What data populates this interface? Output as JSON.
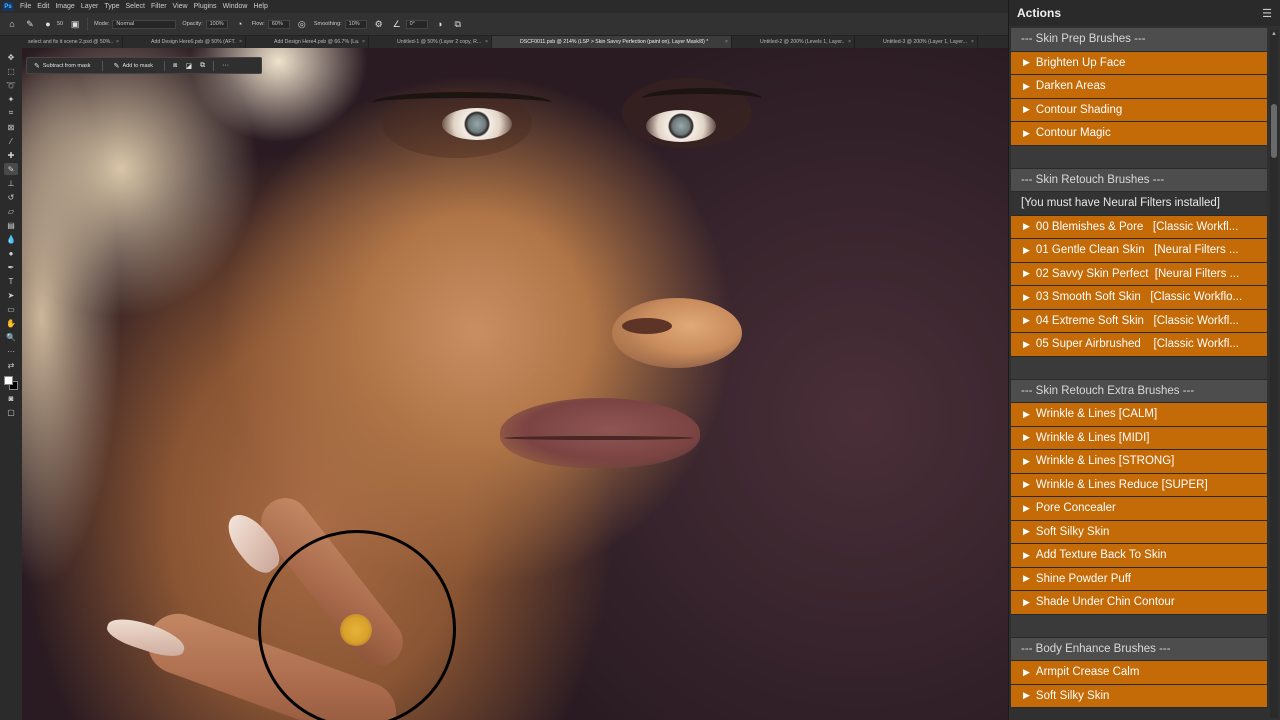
{
  "menu": [
    "File",
    "Edit",
    "Image",
    "Layer",
    "Type",
    "Select",
    "Filter",
    "View",
    "Plugins",
    "Window",
    "Help"
  ],
  "options": {
    "brush_size": "50",
    "mode_label": "Mode:",
    "mode_value": "Normal",
    "opacity_label": "Opacity:",
    "opacity_value": "100%",
    "flow_label": "Flow:",
    "flow_value": "60%",
    "smoothing_label": "Smoothing:",
    "smoothing_value": "10%",
    "angle_value": "0°"
  },
  "tabs": [
    {
      "label": "select and fix it scene 2.psd @ 50%...",
      "active": false
    },
    {
      "label": "Add Design Here6.psb @ 50% (AFT...",
      "active": false
    },
    {
      "label": "Add Design Here4.psb @ 66.7% (La...",
      "active": false
    },
    {
      "label": "Untitled-1 @ 50% (Layer 2 copy, R...",
      "active": false
    },
    {
      "label": "DSCF0011.psb @ 214% (LSP > Skin Savvy Perfection (paint on), Layer Mask/8) *",
      "active": true
    },
    {
      "label": "Untitled-2 @ 200% (Levels 1, Layer...",
      "active": false
    },
    {
      "label": "Untitled-3 @ 200% (Layer 1, Layer...",
      "active": false
    }
  ],
  "mask_tools": {
    "subtract_label": "Subtract from mask",
    "add_label": "Add to mask",
    "more_label": "···"
  },
  "panel": {
    "title": "Actions",
    "rows": [
      {
        "type": "header",
        "label": "--- Skin Prep Brushes ---"
      },
      {
        "type": "action",
        "label": "Brighten Up Face"
      },
      {
        "type": "action",
        "label": "Darken Areas"
      },
      {
        "type": "action",
        "label": "Contour Shading"
      },
      {
        "type": "action",
        "label": "Contour Magic"
      },
      {
        "type": "spacer",
        "label": ""
      },
      {
        "type": "header",
        "label": "--- Skin Retouch Brushes ---"
      },
      {
        "type": "note",
        "label": "[You must have Neural Filters installed]"
      },
      {
        "type": "action",
        "label": "00 Blemishes & Pore   [Classic Workfl..."
      },
      {
        "type": "action",
        "label": "01 Gentle Clean Skin   [Neural Filters ..."
      },
      {
        "type": "action",
        "label": "02 Savvy Skin Perfect  [Neural Filters ..."
      },
      {
        "type": "action",
        "label": "03 Smooth Soft Skin   [Classic Workflo..."
      },
      {
        "type": "action",
        "label": "04 Extreme Soft Skin   [Classic Workfl..."
      },
      {
        "type": "action",
        "label": "05 Super Airbrushed    [Classic Workfl..."
      },
      {
        "type": "spacer",
        "label": ""
      },
      {
        "type": "header",
        "label": "--- Skin Retouch Extra Brushes ---"
      },
      {
        "type": "action",
        "label": "Wrinkle & Lines [CALM]"
      },
      {
        "type": "action",
        "label": "Wrinkle & Lines [MIDI]"
      },
      {
        "type": "action",
        "label": "Wrinkle & Lines [STRONG]"
      },
      {
        "type": "action",
        "label": "Wrinkle & Lines Reduce [SUPER]"
      },
      {
        "type": "action",
        "label": "Pore Concealer"
      },
      {
        "type": "action",
        "label": "Soft Silky Skin"
      },
      {
        "type": "action",
        "label": "Add Texture Back To Skin"
      },
      {
        "type": "action",
        "label": "Shine Powder Puff"
      },
      {
        "type": "action",
        "label": "Shade Under Chin Contour"
      },
      {
        "type": "spacer",
        "label": ""
      },
      {
        "type": "header",
        "label": "--- Body Enhance Brushes ---"
      },
      {
        "type": "action",
        "label": "Armpit Crease Calm"
      },
      {
        "type": "action",
        "label": "Soft Silky Skin"
      }
    ]
  },
  "colors": {
    "action_row": "#c46a06",
    "header_row": "#4d4d4d",
    "foreground": "#ffffff",
    "background": "#000000",
    "brush_cursor": "#000000"
  }
}
